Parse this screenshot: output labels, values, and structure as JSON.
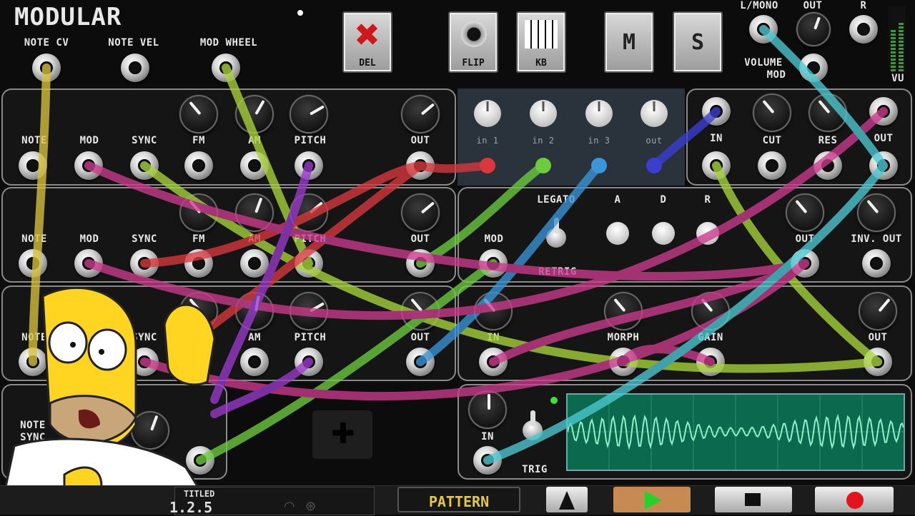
{
  "app": {
    "title": "Modular"
  },
  "header": {
    "inputs": [
      "NOTE CV",
      "NOTE VEL",
      "MOD WHEEL"
    ],
    "buttons": {
      "del": "DEL",
      "flip": "FLIP",
      "kb": "KB",
      "m": "M",
      "s": "S"
    },
    "output": {
      "lmono": "L/MONO",
      "out": "OUT",
      "r": "R",
      "volume": "VOLUME",
      "mod": "MOD",
      "vu": "VU"
    }
  },
  "oscillator": {
    "labels": [
      "NOTE",
      "MOD",
      "SYNC",
      "FM",
      "AM",
      "PITCH",
      "OUT"
    ]
  },
  "osc3": {
    "labels": [
      "NOTE",
      "SYNC",
      "AM",
      "PITCH",
      "OUT"
    ]
  },
  "lfo": {
    "labels": [
      "NOTE",
      "SYNC"
    ]
  },
  "mixer": {
    "labels": [
      "in 1",
      "in 2",
      "in 3",
      "out"
    ]
  },
  "filter": {
    "labels": [
      "IN",
      "CUT",
      "RES",
      "OUT"
    ]
  },
  "envelope": {
    "legato": "LEGATO",
    "retrig": "RETRIG",
    "mod": "MOD",
    "a": "A",
    "d": "D",
    "r": "R",
    "out": "OUT",
    "inv_out": "INV. OUT"
  },
  "morph": {
    "in": "IN",
    "morph": "MORPH",
    "gain": "GAIN",
    "out": "OUT"
  },
  "scope": {
    "in": "IN",
    "trig": "TRIG"
  },
  "footer": {
    "song": "TITLED",
    "version": "1.2.5",
    "pattern": "PATTERN"
  },
  "colors": {
    "yellow": "#d8c23c",
    "lime": "#a8d43a",
    "green": "#6ccc3e",
    "red": "#d8383e",
    "magenta": "#cc3b8e",
    "purple": "#9b3bcb",
    "blue": "#3a96d8",
    "cyan": "#4ec9d2",
    "navy": "#3a3fd0"
  }
}
